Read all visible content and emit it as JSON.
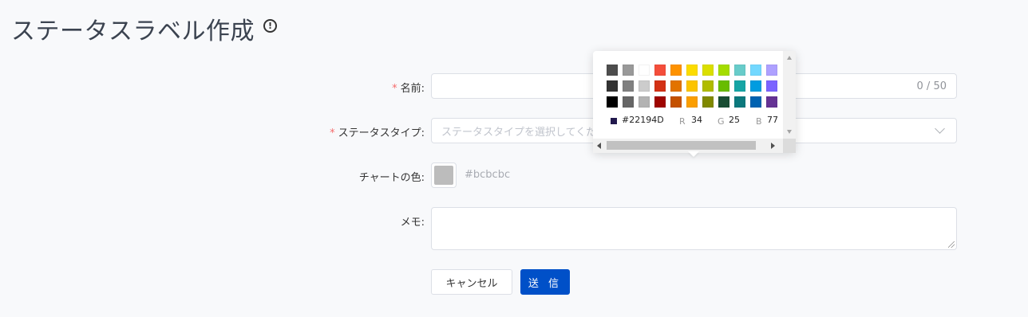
{
  "page": {
    "title": "ステータスラベル作成",
    "info_icon": "info-circle-icon"
  },
  "form": {
    "name": {
      "label": "名前:",
      "required": "*",
      "value": "",
      "counter": "0 / 50"
    },
    "status_type": {
      "label": "ステータスタイプ:",
      "required": "*",
      "placeholder": "ステータスタイプを選択してください"
    },
    "chart_color": {
      "label": "チャートの色:",
      "value": "#bcbcbc",
      "swatch_color": "#bcbcbc"
    },
    "memo": {
      "label": "メモ:",
      "value": ""
    }
  },
  "buttons": {
    "cancel": "キャンセル",
    "submit": "送 信"
  },
  "color_picker": {
    "palette": [
      [
        "#4d4d4d",
        "#999999",
        "#ffffff",
        "#f44e3b",
        "#fe9200",
        "#fcdc00",
        "#dbdf00",
        "#a4dd00",
        "#68ccca",
        "#73d8ff",
        "#aea1ff"
      ],
      [
        "#333333",
        "#808080",
        "#cccccc",
        "#d33115",
        "#e27300",
        "#fcc400",
        "#b0bc00",
        "#68bc00",
        "#16a5a5",
        "#009ce0",
        "#7b64ff"
      ],
      [
        "#000000",
        "#666666",
        "#b3b3b3",
        "#9f0500",
        "#c45100",
        "#fb9e00",
        "#808900",
        "#194d33",
        "#0c797d",
        "#0062b1",
        "#653294"
      ]
    ],
    "current_color": "#22194D",
    "hex": "#22194D",
    "r_label": "R",
    "r": "34",
    "g_label": "G",
    "g": "25",
    "b_label": "B",
    "b": "77"
  }
}
